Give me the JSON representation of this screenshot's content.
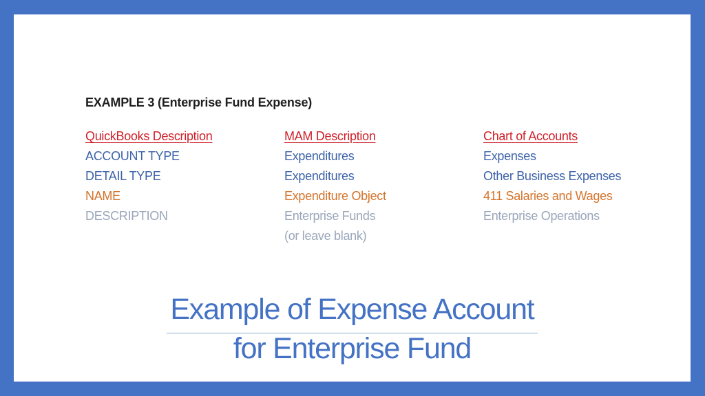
{
  "slide": {
    "heading": "EXAMPLE 3 (Enterprise Fund Expense)",
    "columns": [
      {
        "header": "QuickBooks Description",
        "rows": [
          "ACCOUNT TYPE",
          "DETAIL TYPE",
          "NAME",
          "DESCRIPTION",
          ""
        ]
      },
      {
        "header": "MAM Description",
        "rows": [
          "Expenditures",
          "Expenditures",
          "Expenditure Object",
          "Enterprise Funds",
          "(or leave blank)"
        ]
      },
      {
        "header": "Chart of Accounts",
        "rows": [
          "Expenses",
          "Other Business Expenses",
          "411 Salaries and Wages",
          "Enterprise Operations",
          ""
        ]
      }
    ],
    "title_line1": "Example of Expense Account",
    "title_line2": "for Enterprise Fund"
  },
  "colors": {
    "frame": "#4472c4",
    "header_red": "#d0202a",
    "blue": "#3c62a8",
    "orange": "#d4742b",
    "gray": "#9aa6ba",
    "title_blue": "#4472c4"
  }
}
